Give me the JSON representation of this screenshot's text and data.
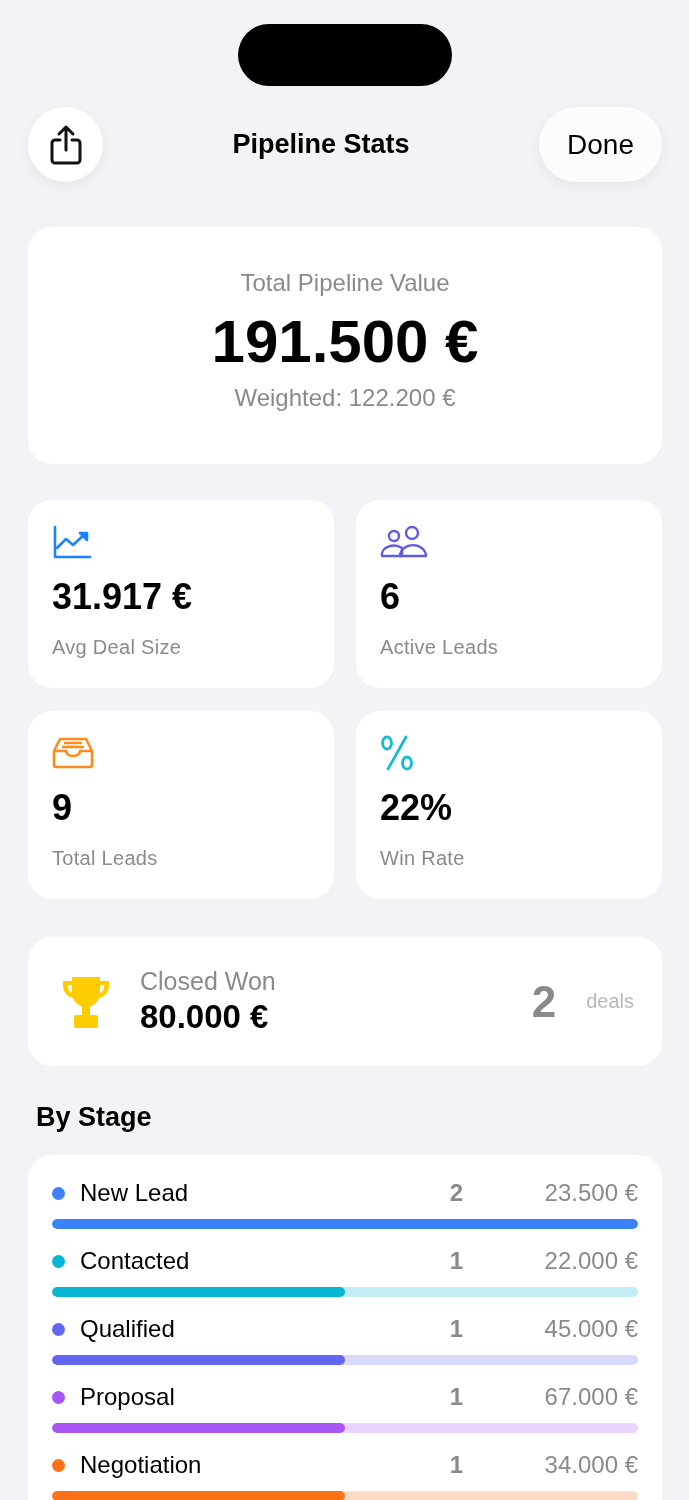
{
  "header": {
    "title": "Pipeline Stats",
    "done_button": "Done"
  },
  "summary": {
    "label": "Total Pipeline Value",
    "value": "191.500 €",
    "weighted": "Weighted: 122.200 €"
  },
  "stats": [
    {
      "kind": "trend",
      "color": "#1a84ff",
      "value": "31.917 €",
      "label": "Avg Deal Size"
    },
    {
      "kind": "people",
      "color": "#5e5ce6",
      "value": "6",
      "label": "Active Leads"
    },
    {
      "kind": "tray",
      "color": "#ff8c1a",
      "value": "9",
      "label": "Total Leads"
    },
    {
      "kind": "percent",
      "color": "#13bcd0",
      "value": "22%",
      "label": "Win Rate"
    }
  ],
  "closed_won": {
    "label": "Closed Won",
    "value": "80.000 €",
    "count": "2",
    "unit": "deals"
  },
  "by_stage": {
    "title": "By Stage",
    "stages": [
      {
        "name": "New Lead",
        "color": "#3b82f6",
        "count": "2",
        "amount": "23.500 €",
        "level": 1
      },
      {
        "name": "Contacted",
        "color": "#06b6d4",
        "count": "1",
        "amount": "22.000 €",
        "level": 0.5
      },
      {
        "name": "Qualified",
        "color": "#6366f1",
        "count": "1",
        "amount": "45.000 €",
        "level": 0.5
      },
      {
        "name": "Proposal",
        "color": "#a855f7",
        "count": "1",
        "amount": "67.000 €",
        "level": 0.5
      },
      {
        "name": "Negotiation",
        "color": "#f97316",
        "count": "1",
        "amount": "34.000 €",
        "level": 0.5
      }
    ]
  }
}
